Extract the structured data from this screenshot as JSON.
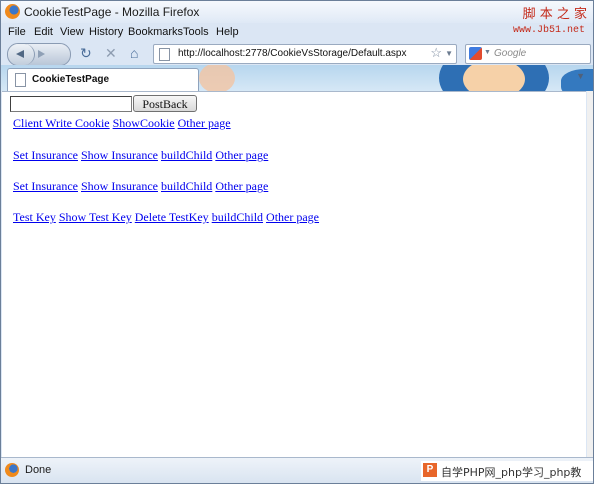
{
  "window": {
    "title": "CookieTestPage - Mozilla Firefox",
    "watermark": "脚 本 之 家",
    "watermark_url": "www.Jb51.net"
  },
  "menu": [
    "File",
    "Edit",
    "View",
    "History",
    "Bookmarks",
    "Tools",
    "Help"
  ],
  "navbar": {
    "url": "http://localhost:2778/CookieVsStorage/Default.aspx",
    "search_placeholder": "Google",
    "reload_icon": "reload-icon",
    "stop_icon": "stop-icon",
    "home_icon": "home-icon"
  },
  "tab": {
    "title": "CookieTestPage"
  },
  "content": {
    "input_value": "",
    "postback_label": "PostBack",
    "rows": [
      [
        "Client Write Cookie",
        "ShowCookie",
        "Other page"
      ],
      [
        "Set Insurance",
        "Show Insurance",
        "buildChild",
        "Other page"
      ],
      [
        "Set Insurance",
        "Show Insurance",
        "buildChild",
        "Other page"
      ],
      [
        "Test Key",
        "Show Test Key",
        "Delete TestKey",
        "buildChild",
        "Other page"
      ]
    ]
  },
  "status": {
    "text": "Done",
    "footer_watermark": "自学PHP网_php学习_php教"
  }
}
